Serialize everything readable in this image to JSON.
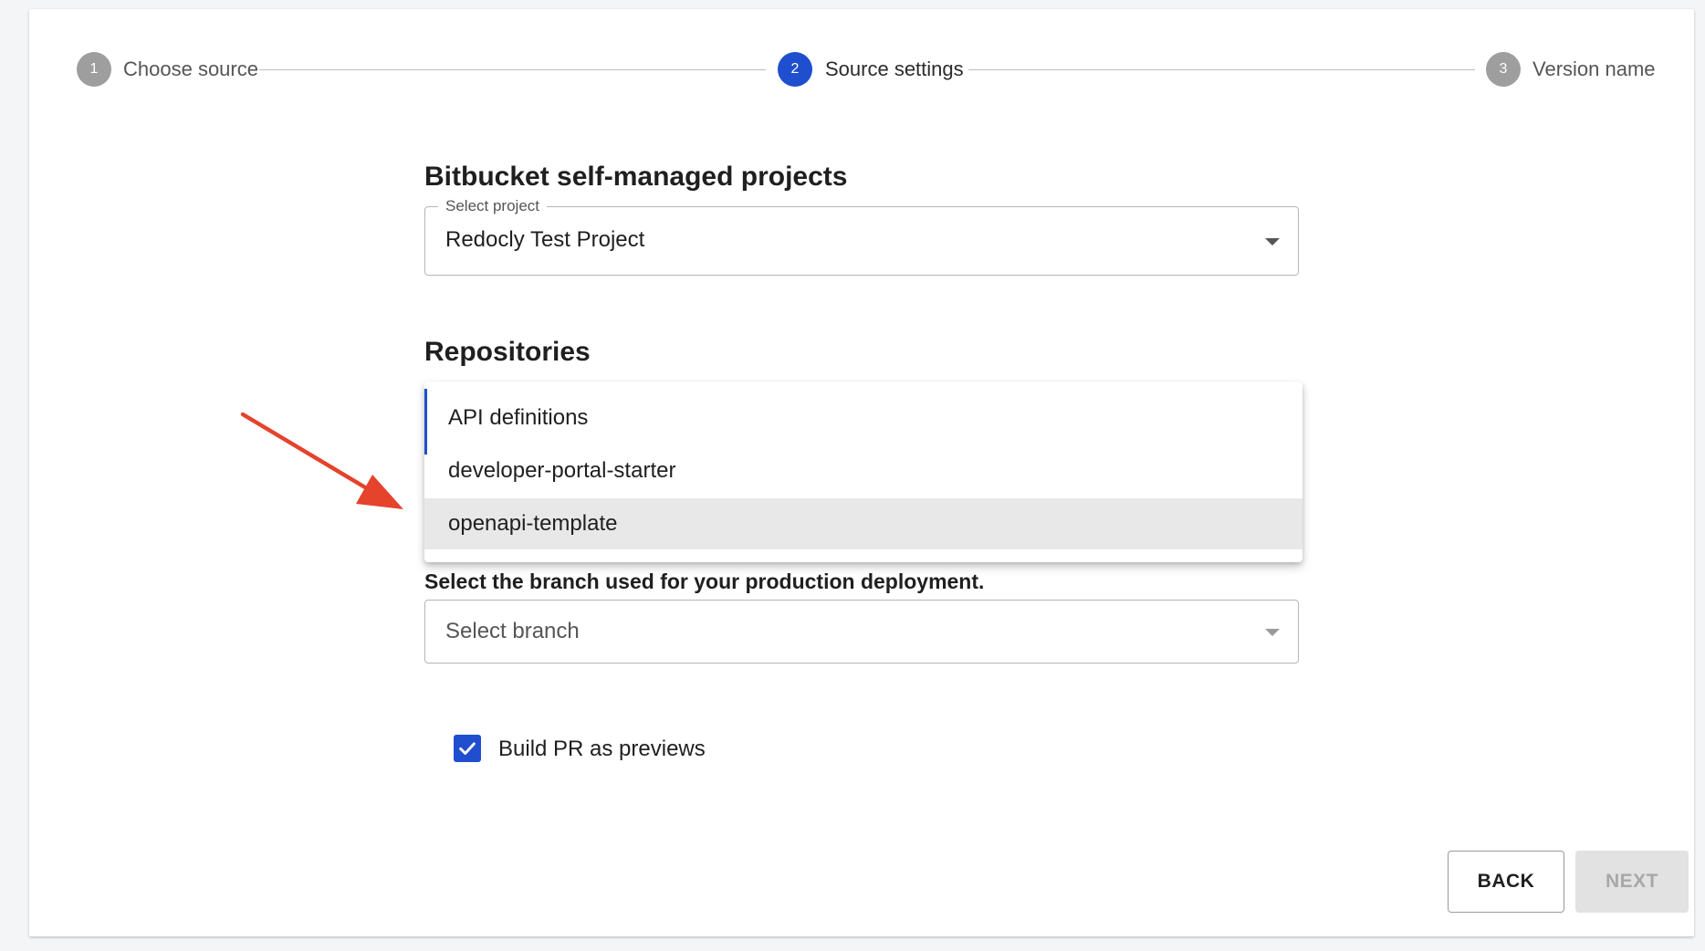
{
  "stepper": {
    "steps": [
      {
        "number": "1",
        "label": "Choose source",
        "state": "completed"
      },
      {
        "number": "2",
        "label": "Source settings",
        "state": "active"
      },
      {
        "number": "3",
        "label": "Version name",
        "state": "pending"
      }
    ]
  },
  "project_section": {
    "title": "Bitbucket self-managed projects",
    "select_label": "Select project",
    "selected_value": "Redocly Test Project"
  },
  "repositories_section": {
    "title": "Repositories",
    "options": [
      {
        "label": "API definitions"
      },
      {
        "label": "developer-portal-starter"
      },
      {
        "label": "openapi-template",
        "highlighted": true
      }
    ]
  },
  "branch_section": {
    "label": "Select the branch used for your production deployment.",
    "placeholder": "Select branch"
  },
  "preview_option": {
    "label": "Build PR as previews",
    "checked": true
  },
  "actions": {
    "back_label": "BACK",
    "next_label": "NEXT",
    "next_disabled": true
  },
  "colors": {
    "accent": "#1f4fcf",
    "arrow": "#e5432c",
    "step_inactive": "#9e9e9e",
    "highlight": "#e8e8e8"
  },
  "icons": {
    "dropdown_caret": "caret-down-icon",
    "checkbox": "check-icon",
    "annotation": "red-arrow-icon"
  }
}
